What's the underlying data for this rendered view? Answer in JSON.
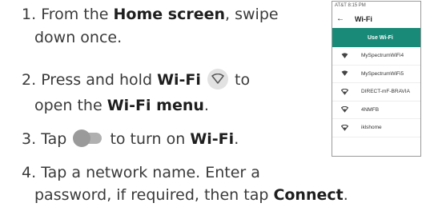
{
  "steps": [
    {
      "num": "1.",
      "pre": "From the ",
      "bold": "Home screen",
      "post": ", swipe",
      "cont": "down once."
    },
    {
      "num": "2.",
      "pre": "Press and hold ",
      "bold": "Wi-Fi",
      "post": " to",
      "cont_pre": "open the ",
      "cont_bold": "Wi-Fi menu",
      "cont_post": "."
    },
    {
      "num": "3.",
      "pre": "Tap ",
      "post": " to turn on ",
      "bold": "Wi-Fi",
      "end": "."
    },
    {
      "num": "4.",
      "pre": "Tap a network name. Enter a",
      "cont_pre": "password, if required, then tap ",
      "cont_bold": "Connect",
      "cont_post": "."
    }
  ],
  "phone": {
    "status": "AT&T 8:15 PM",
    "back_icon": "arrow-left-icon",
    "title": "Wi-Fi",
    "toggle_label": "Use Wi-Fi",
    "networks": [
      {
        "name": "MySpectrumWiFi4",
        "icon": "wifi-filled-icon"
      },
      {
        "name": "MySpectrumWiFi5",
        "icon": "wifi-filled-icon"
      },
      {
        "name": "DIRECT-mF-BRAVIA",
        "icon": "wifi-outline-icon"
      },
      {
        "name": "4NMFB",
        "icon": "wifi-outline-icon"
      },
      {
        "name": "iklshome",
        "icon": "wifi-outline-icon"
      }
    ]
  },
  "colors": {
    "accent": "#1a8a78",
    "text": "#3a3a3a",
    "bold_text": "#1e1e1e"
  }
}
